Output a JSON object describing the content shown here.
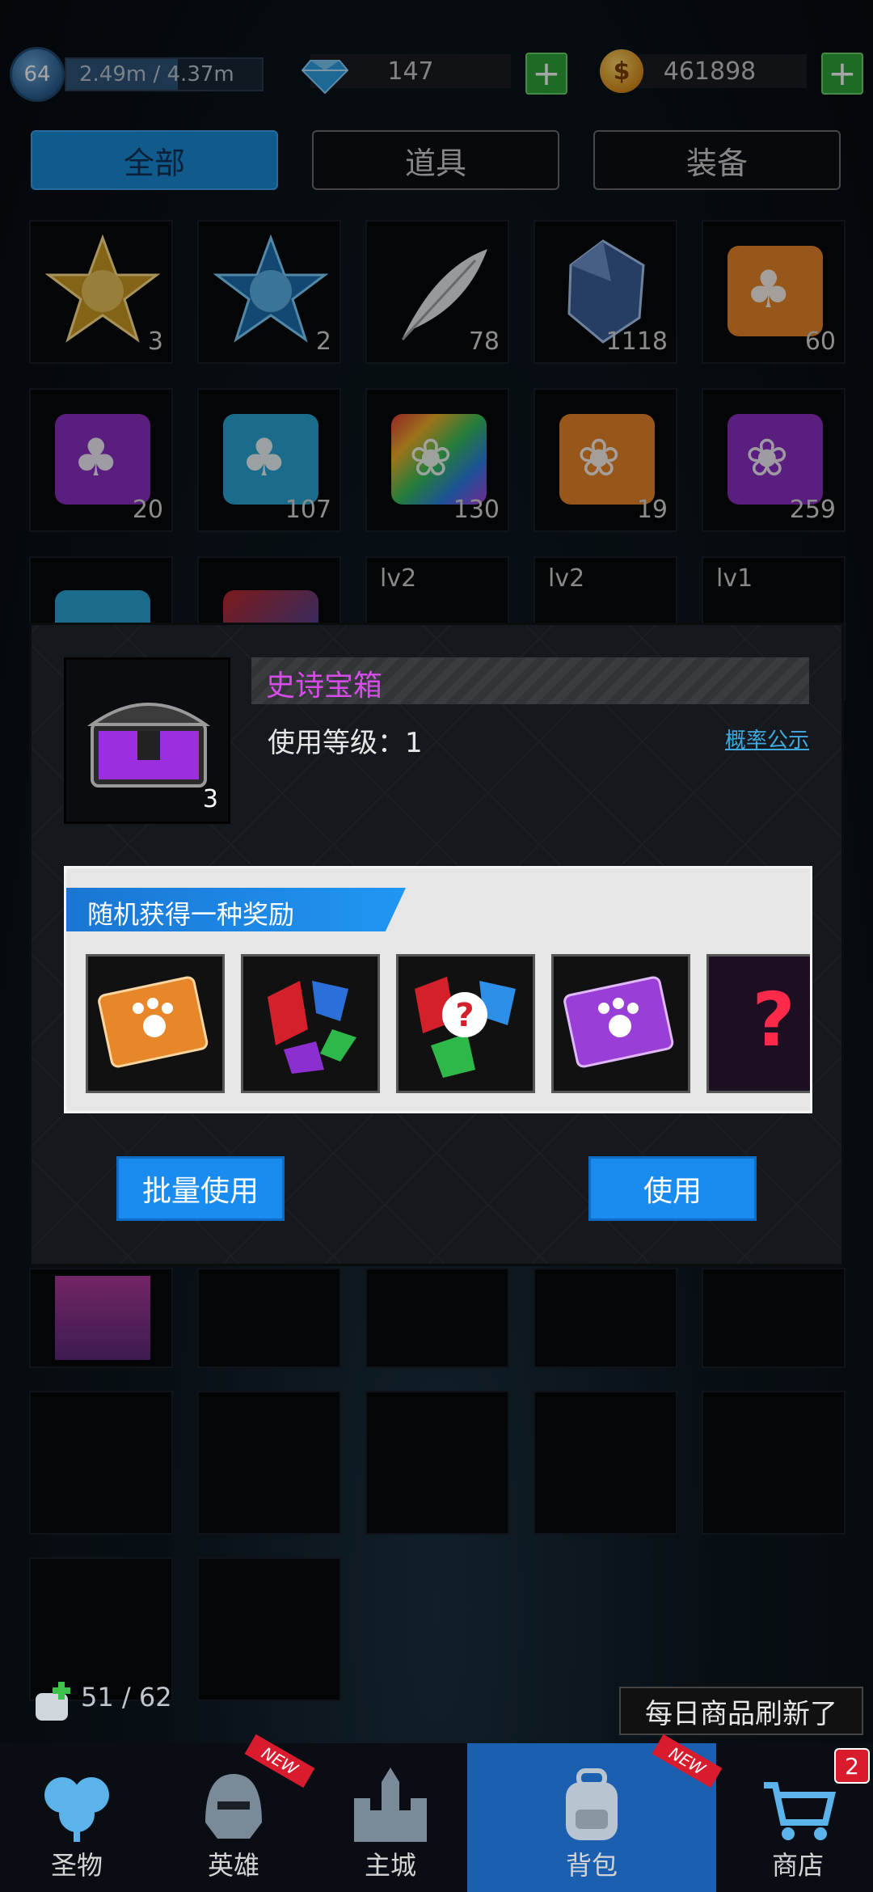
{
  "header": {
    "level": "64",
    "exp_text": "2.49m / 4.37m",
    "exp_progress": 0.57,
    "gems": "147",
    "gold": "461898",
    "gem_icon": "diamond-icon",
    "coin_icon": "gold-coin-icon",
    "coin_symbol": "$",
    "plus_symbol": "+"
  },
  "tabs": [
    {
      "label": "全部",
      "active": true
    },
    {
      "label": "道具",
      "active": false
    },
    {
      "label": "装备",
      "active": false
    }
  ],
  "grid": {
    "row1": [
      {
        "icon": "gold-star-rune-icon",
        "count": "3"
      },
      {
        "icon": "blue-star-rune-icon",
        "count": "2"
      },
      {
        "icon": "white-feather-icon",
        "count": "78"
      },
      {
        "icon": "blue-crystal-icon",
        "count": "1118"
      },
      {
        "icon": "orange-clover-puzzle-icon",
        "count": "60"
      }
    ],
    "row2": [
      {
        "icon": "purple-clover-puzzle-icon",
        "count": "20"
      },
      {
        "icon": "blue-clover-puzzle-icon",
        "count": "107"
      },
      {
        "icon": "rainbow-paw-puzzle-icon",
        "count": "130"
      },
      {
        "icon": "orange-paw-puzzle-icon",
        "count": "19"
      },
      {
        "icon": "purple-paw-puzzle-icon",
        "count": "259"
      }
    ],
    "row3_levels": [
      "lv2",
      "lv2",
      "lv1"
    ]
  },
  "popup": {
    "item_name": "史诗宝箱",
    "item_count": "3",
    "use_level": "使用等级：1",
    "probability_link": "概率公示",
    "reward_title": "随机获得一种奖励",
    "rewards": [
      {
        "icon": "orange-paw-ticket-icon"
      },
      {
        "icon": "gem-shards-icon"
      },
      {
        "icon": "random-gems-icon",
        "mark": "?"
      },
      {
        "icon": "purple-paw-ticket-icon"
      },
      {
        "icon": "random-item-icon",
        "mark": "?"
      }
    ],
    "batch_use_label": "批量使用",
    "use_label": "使用"
  },
  "bag": {
    "count_text": "51 / 62"
  },
  "toast": "每日商品刷新了",
  "nav": [
    {
      "label": "圣物",
      "icon": "clover-icon",
      "new": false,
      "active": false
    },
    {
      "label": "英雄",
      "icon": "helmet-icon",
      "new": true,
      "active": false
    },
    {
      "label": "主城",
      "icon": "castle-icon",
      "new": false,
      "active": false
    },
    {
      "label": "背包",
      "icon": "backpack-icon",
      "new": true,
      "active": true
    },
    {
      "label": "商店",
      "icon": "shopping-cart-icon",
      "new": false,
      "active": false
    }
  ],
  "shop_badge": "2",
  "new_tag": "NEW",
  "colors": {
    "accent_blue": "#1a8cf0",
    "epic_purple": "#d64ce8",
    "plus_green": "#2fa53b",
    "badge_red": "#d81c2e"
  }
}
